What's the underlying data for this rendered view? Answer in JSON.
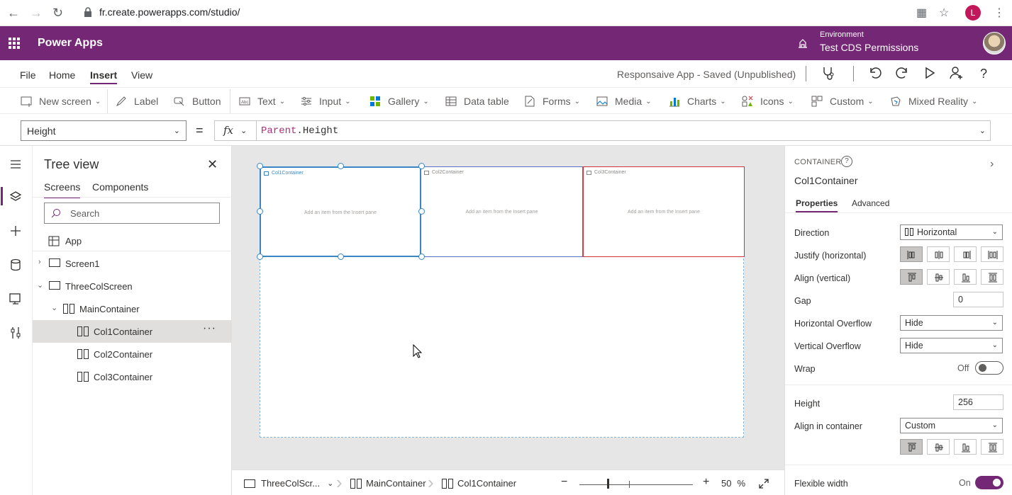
{
  "browser": {
    "url": "fr.create.powerapps.com/studio/",
    "profile_initial": "L"
  },
  "appbar": {
    "app_name": "Power Apps",
    "environment_label": "Environment",
    "environment_name": "Test CDS Permissions"
  },
  "menu": {
    "items": [
      "File",
      "Home",
      "Insert",
      "View"
    ],
    "active": "Insert",
    "save_status": "Responsaive App - Saved (Unpublished)"
  },
  "toolbar": {
    "new_screen": "New screen",
    "label": "Label",
    "button": "Button",
    "text": "Text",
    "input": "Input",
    "gallery": "Gallery",
    "data_table": "Data table",
    "forms": "Forms",
    "media": "Media",
    "charts": "Charts",
    "icons": "Icons",
    "custom": "Custom",
    "mixed_reality": "Mixed Reality"
  },
  "formula_bar": {
    "property": "Height",
    "equals": "=",
    "fx": "fx",
    "formula_object": "Parent",
    "formula_rest": ".Height"
  },
  "tree": {
    "title": "Tree view",
    "tabs": [
      "Screens",
      "Components"
    ],
    "active_tab": "Screens",
    "search_placeholder": "Search",
    "app": "App",
    "rows": [
      {
        "label": "Screen1"
      },
      {
        "label": "ThreeColScreen"
      },
      {
        "label": "MainContainer"
      },
      {
        "label": "Col1Container",
        "selected": true
      },
      {
        "label": "Col2Container"
      },
      {
        "label": "Col3Container"
      }
    ]
  },
  "canvas": {
    "columns": [
      {
        "title": "Col1Container",
        "hint": "Add an item from the Insert pane",
        "color": "#3a86c4"
      },
      {
        "title": "Col2Container",
        "hint": "Add an item from the Insert pane",
        "color": "#5b6fc7"
      },
      {
        "title": "Col3Container",
        "hint": "Add an item from the Insert pane",
        "color": "#d13438"
      }
    ]
  },
  "bottombar": {
    "screen": "ThreeColScr...",
    "container": "MainContainer",
    "control": "Col1Container",
    "zoom_value": "50",
    "zoom_unit": "%"
  },
  "props": {
    "kind": "CONTAINER",
    "name": "Col1Container",
    "tabs": [
      "Properties",
      "Advanced"
    ],
    "active_tab": "Properties",
    "direction_label": "Direction",
    "direction_value": "Horizontal",
    "justify_label": "Justify (horizontal)",
    "align_label": "Align (vertical)",
    "gap_label": "Gap",
    "gap_value": "0",
    "hoverflow_label": "Horizontal Overflow",
    "hoverflow_value": "Hide",
    "voverflow_label": "Vertical Overflow",
    "voverflow_value": "Hide",
    "wrap_label": "Wrap",
    "wrap_state": "Off",
    "height_label": "Height",
    "height_value": "256",
    "align_in_container_label": "Align in container",
    "align_in_container_value": "Custom",
    "flexible_width_label": "Flexible width",
    "flexible_width_state": "On"
  },
  "colors": {
    "brand": "#742774",
    "selection": "#3a86c4"
  }
}
